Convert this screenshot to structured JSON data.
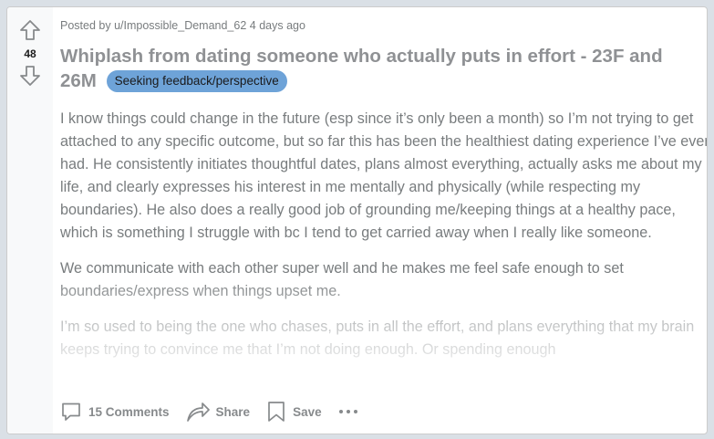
{
  "post": {
    "score": "48",
    "meta": "Posted by u/Impossible_Demand_62 4 days ago",
    "title": "Whiplash from dating someone who actually puts in effort - 23F and 26M",
    "flair": "Seeking feedback/perspective",
    "paragraphs": [
      "I know things could change in the future (esp since it’s only been a month) so I’m not trying to get attached to any specific outcome, but so far this has been the healthiest dating experience I’ve ever had. He consistently initiates thoughtful dates, plans almost everything, actually asks me about my life, and clearly expresses his interest in me mentally and physically (while respecting my boundaries). He also does a really good job of grounding me/keeping things at a healthy pace, which is something I struggle with bc I tend to get carried away when I really like someone.",
      "We communicate with each other super well and he makes me feel safe enough to set boundaries/express when things upset me.",
      "I’m so used to being the one who chases, puts in all the effort, and plans everything that my brain keeps trying to convince me that I’m not doing enough. Or spending enough"
    ]
  },
  "actions": {
    "comments": "15 Comments",
    "share": "Share",
    "save": "Save"
  },
  "icons": {
    "upvote": "upvote-icon",
    "downvote": "downvote-icon",
    "comment": "comment-icon",
    "share": "share-icon",
    "save": "bookmark-icon",
    "more": "more-icon"
  },
  "colors": {
    "flair_bg": "#6ea3d8",
    "muted_text": "#787c7e",
    "title_text": "#8f9194"
  }
}
